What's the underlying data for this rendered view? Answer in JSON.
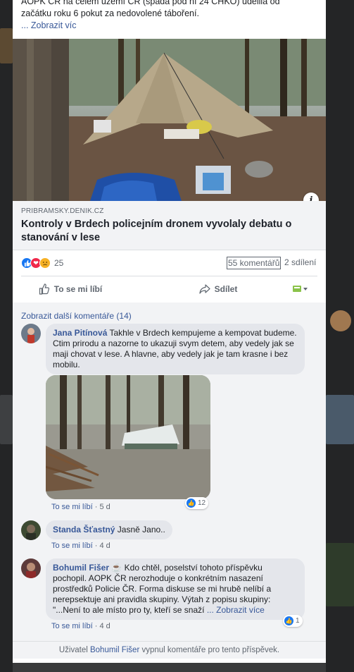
{
  "post": {
    "text_line1": "AOPK ČR na celém území ČR (spadá pod ní 24 CHKO) udělila od",
    "text_line2": "začátku roku 6 pokut za nedovolené táboření.",
    "see_more": "... Zobrazit víc"
  },
  "link": {
    "domain": "PRIBRAMSKY.DENIK.CZ",
    "title": "Kontroly v Brdech policejním dronem vyvolaly debatu o stanování v lese"
  },
  "stats": {
    "reaction_count": "25",
    "comments": "55 komentářů",
    "shares": "2 sdílení"
  },
  "actions": {
    "like": "To se mi líbí",
    "share": "Sdílet"
  },
  "comments": {
    "view_more": "Zobrazit další komentáře (14)",
    "items": [
      {
        "author": "Jana Pitínová",
        "text": "Takhle v Brdech kempujeme a kempovat budeme. Ctim prirodu a nazorne to ukazuji svym detem, aby vedely jak se maji chovat v lese. A hlavne, aby vedely jak je tam krasne i bez mobilu.",
        "like": "To se mi líbí",
        "time": "5 d",
        "reactions": "12"
      },
      {
        "author": "Standa Šťastný",
        "text": "Jasně Jano..",
        "like": "To se mi líbí",
        "time": "4 d"
      },
      {
        "author": "Bohumil Fišer",
        "author_badge": "☕",
        "text": "Kdo chtěl, poselství tohoto příspěvku pochopil. AOPK ČR nerozhoduje o konkrétním nasazení prostředků Policie ČR. Forma diskuse se mi hrubě nelíbí a nerepsektuje ani pravidla skupiny. Výtah z popisu skupiny: \"...Není to ale místo pro ty, kteří se snaží",
        "see_more": "... Zobrazit více",
        "like": "To se mi líbí",
        "time": "4 d",
        "reactions": "1"
      }
    ]
  },
  "footer": {
    "prefix": "Uživatel",
    "name": "Bohumil Fišer",
    "suffix": "vypnul komentáře pro tento příspěvek."
  },
  "colors": {
    "link": "#385898",
    "like_blue": "#1877f2",
    "bubble": "#e4e6eb",
    "panel": "#f2f3f5"
  }
}
